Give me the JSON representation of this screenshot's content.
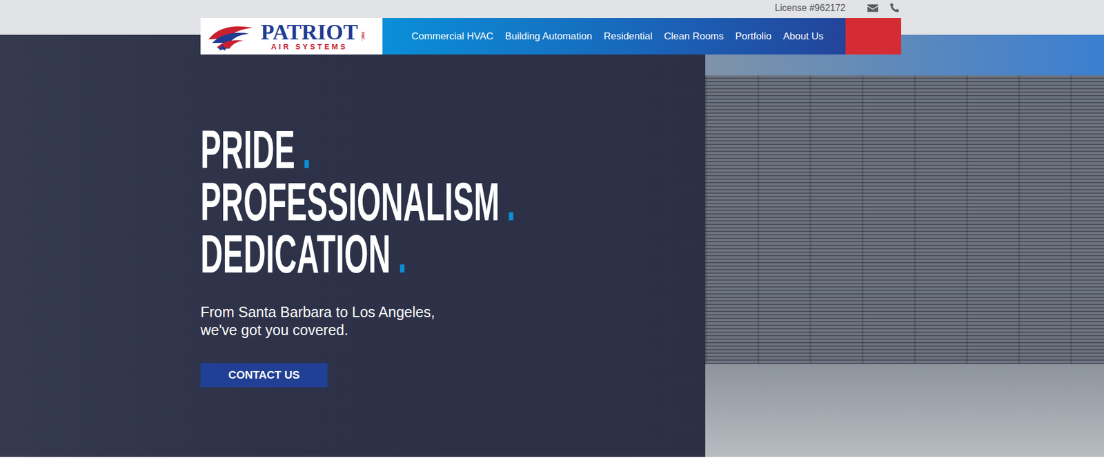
{
  "top_bar": {
    "license": "License #962172",
    "icons": [
      "mail",
      "phone"
    ]
  },
  "logo": {
    "name": "PATRIOT",
    "subtitle": "AIR SYSTEMS",
    "suffix": "INC."
  },
  "nav": {
    "items": [
      "Commercial HVAC",
      "Building Automation",
      "Residential",
      "Clean Rooms",
      "Portfolio",
      "About Us"
    ]
  },
  "hero": {
    "lines": [
      {
        "word": "PRIDE",
        "dot": "."
      },
      {
        "word": "PROFESSIONALISM",
        "dot": "."
      },
      {
        "word": "DEDICATION",
        "dot": "."
      }
    ],
    "subtitle": [
      "From Santa Barbara to Los Angeles,",
      "we've got you covered."
    ],
    "button": "CONTACT US"
  }
}
